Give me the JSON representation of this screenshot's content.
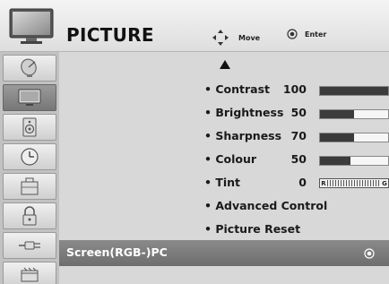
{
  "header": {
    "title": "PICTURE",
    "move_label": "Move",
    "enter_label": "Enter",
    "icon": "tv-icon"
  },
  "sidebar": {
    "items": [
      {
        "icon": "satellite-dish-icon"
      },
      {
        "icon": "tv-picture-icon",
        "active": true
      },
      {
        "icon": "speaker-icon"
      },
      {
        "icon": "clock-icon"
      },
      {
        "icon": "briefcase-icon"
      },
      {
        "icon": "lock-icon"
      },
      {
        "icon": "input-plug-icon"
      },
      {
        "icon": "usb-media-icon"
      }
    ]
  },
  "menu": {
    "items": [
      {
        "label": "• Contrast",
        "value": "100",
        "level": 1.0
      },
      {
        "label": "• Brightness",
        "value": "50",
        "level": 0.5
      },
      {
        "label": "• Sharpness",
        "value": "70",
        "level": 0.5
      },
      {
        "label": "• Colour",
        "value": "50",
        "level": 0.45
      },
      {
        "label": "• Tint",
        "value": "0",
        "tint_left": "R",
        "tint_right": "G"
      },
      {
        "label": "• Advanced Control"
      },
      {
        "label": "• Picture Reset"
      }
    ],
    "selected_label": "Screen(RGB-)PC"
  },
  "colors": {
    "header_bg": "#e8e8e8",
    "sidebar_bg": "#c2c2c2",
    "content_bg": "#d8d8d8",
    "selected_bg": "#7a7a7a",
    "bar_fill": "#3b3b3b"
  }
}
